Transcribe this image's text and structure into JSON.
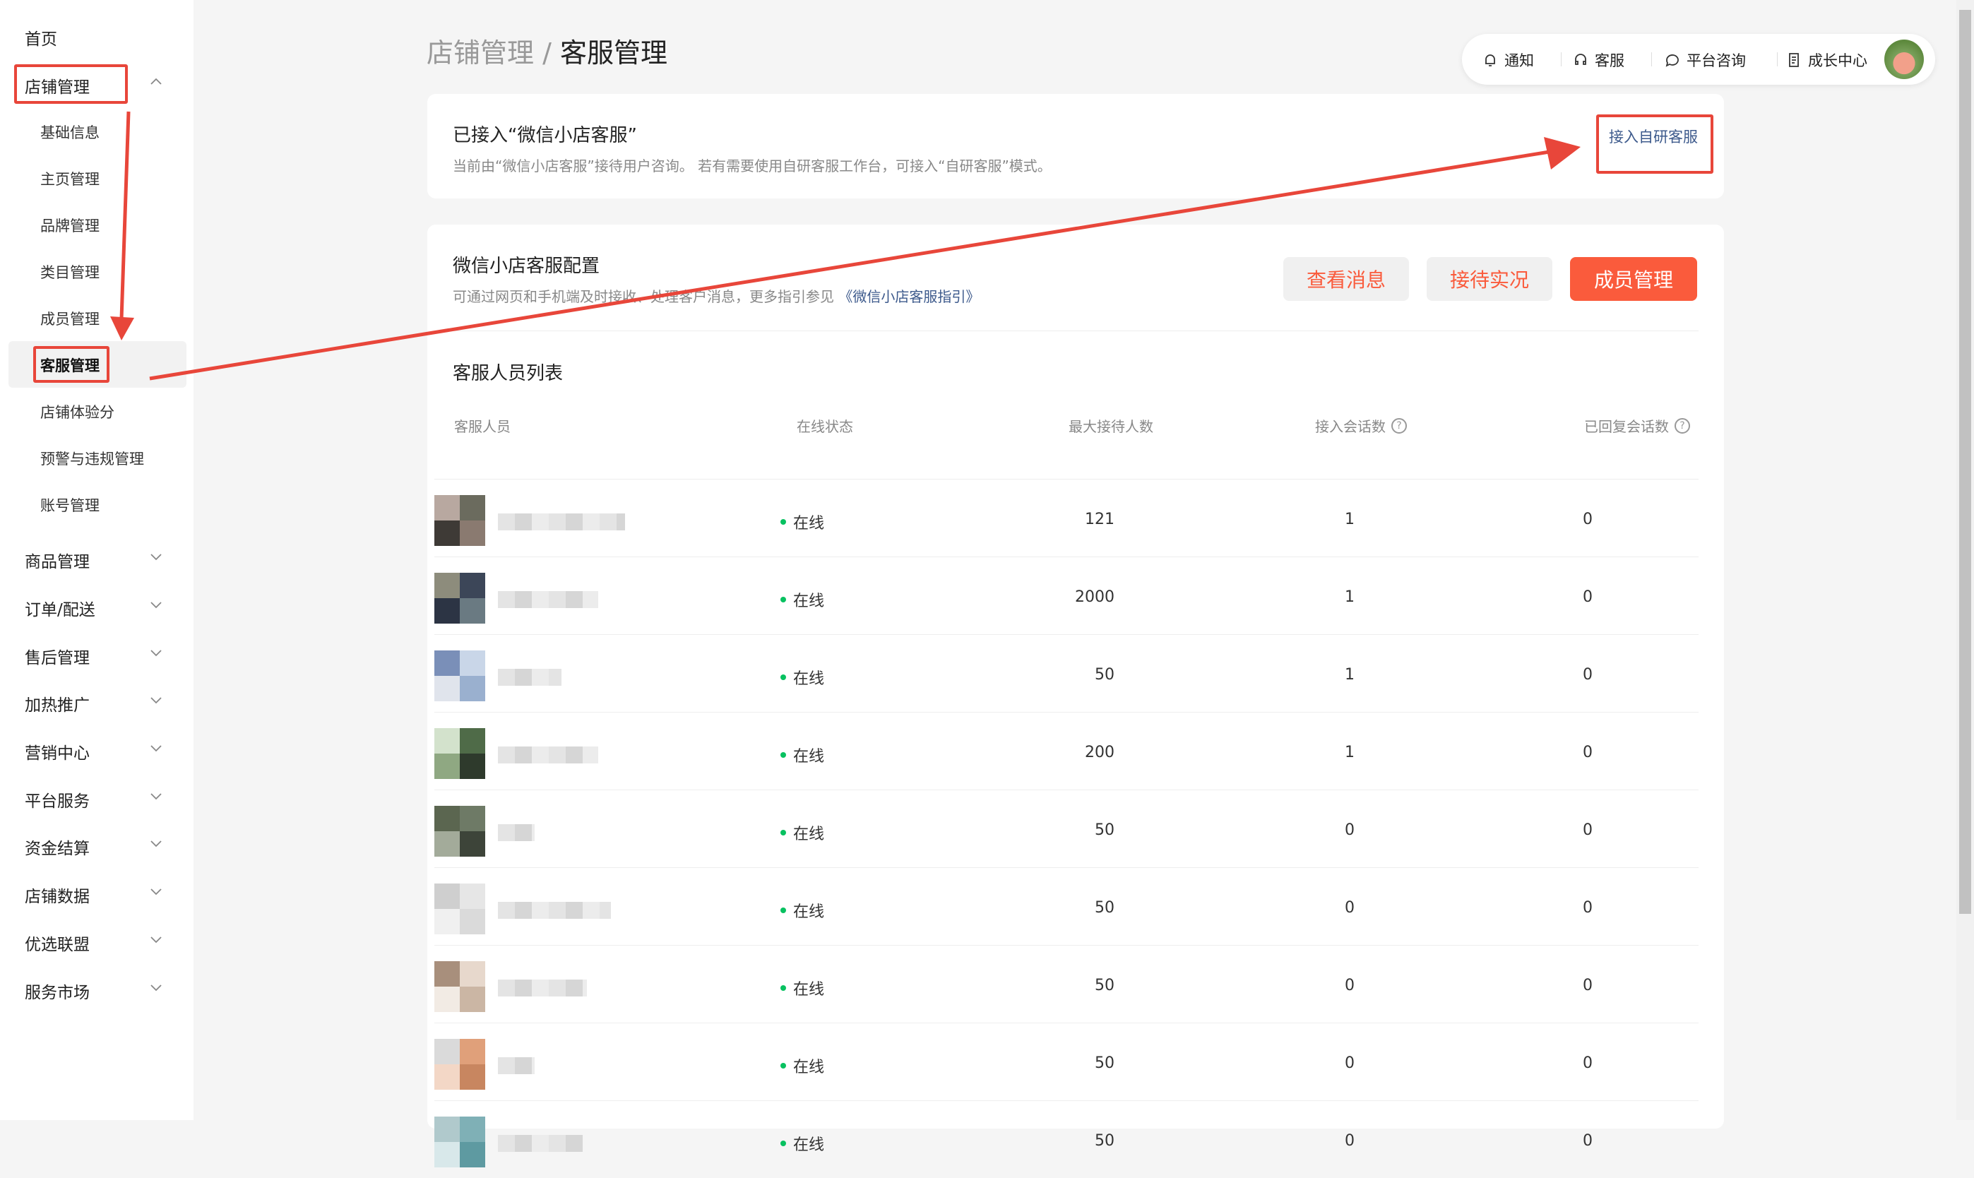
{
  "sidebar": {
    "home": "首页",
    "store_mgmt": "店铺管理",
    "sub_items": [
      "基础信息",
      "主页管理",
      "品牌管理",
      "类目管理",
      "成员管理",
      "客服管理",
      "店铺体验分",
      "预警与违规管理",
      "账号管理"
    ],
    "groups": [
      "商品管理",
      "订单/配送",
      "售后管理",
      "加热推广",
      "营销中心",
      "平台服务",
      "资金结算",
      "店铺数据",
      "优选联盟",
      "服务市场"
    ]
  },
  "breadcrumb": {
    "parent": "店铺管理",
    "sep": "/",
    "current": "客服管理"
  },
  "topbar": {
    "notify": "通知",
    "service": "客服",
    "consult": "平台咨询",
    "growth": "成长中心"
  },
  "card1": {
    "title": "已接入“微信小店客服”",
    "desc": "当前由“微信小店客服”接待用户咨询。 若有需要使用自研客服工作台，可接入“自研客服”模式。",
    "btn": "接入自研客服"
  },
  "card2": {
    "title": "微信小店客服配置",
    "desc": "可通过网页和手机端及时接收、处理客户消息，更多指引参见",
    "link": "《微信小店客服指引》",
    "btn_msg": "查看消息",
    "btn_live": "接待实况",
    "btn_member": "成员管理",
    "list_title": "客服人员列表",
    "columns": [
      "客服人员",
      "在线状态",
      "最大接待人数",
      "接入会话数",
      "已回复会话数"
    ],
    "rows": [
      {
        "status": "在线",
        "max": "121",
        "sessions": "1",
        "replied": "0"
      },
      {
        "status": "在线",
        "max": "2000",
        "sessions": "1",
        "replied": "0"
      },
      {
        "status": "在线",
        "max": "50",
        "sessions": "1",
        "replied": "0"
      },
      {
        "status": "在线",
        "max": "200",
        "sessions": "1",
        "replied": "0"
      },
      {
        "status": "在线",
        "max": "50",
        "sessions": "0",
        "replied": "0"
      },
      {
        "status": "在线",
        "max": "50",
        "sessions": "0",
        "replied": "0"
      },
      {
        "status": "在线",
        "max": "50",
        "sessions": "0",
        "replied": "0"
      },
      {
        "status": "在线",
        "max": "50",
        "sessions": "0",
        "replied": "0"
      },
      {
        "status": "在线",
        "max": "50",
        "sessions": "0",
        "replied": "0"
      }
    ]
  },
  "colors": {
    "accent": "#fa5b3c",
    "annotation": "#e8463a",
    "online": "#07c160"
  }
}
